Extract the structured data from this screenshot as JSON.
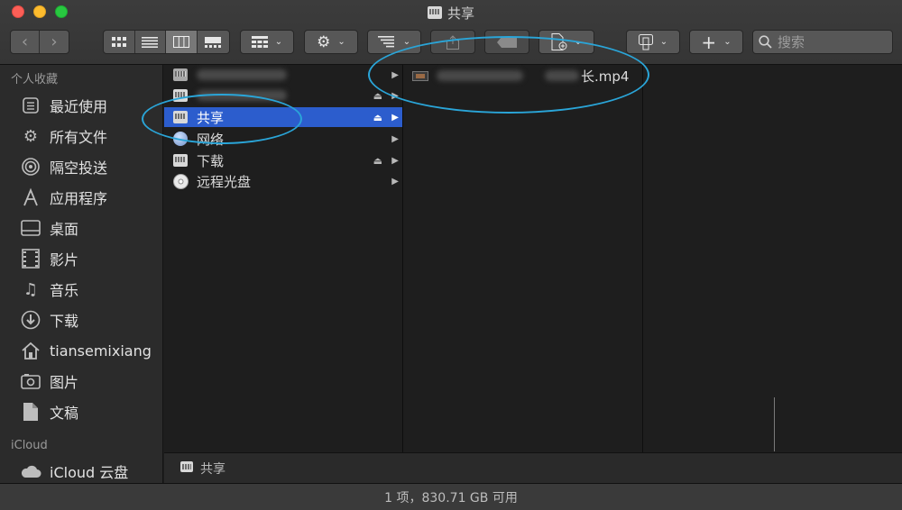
{
  "window": {
    "title": "共享"
  },
  "toolbar": {
    "view_modes": [
      "icon-view",
      "list-view",
      "column-view",
      "gallery-view"
    ],
    "active_view": "column-view",
    "group_by": "group-icon",
    "action": "gear-icon",
    "arrange": "arrange-icon",
    "share": "share-icon",
    "tag": "tag-icon",
    "new_doc": "new-document-icon",
    "dropbox": "dropbox-icon",
    "add": "+",
    "search_placeholder": "搜索"
  },
  "sidebar": {
    "favorites_header": "个人收藏",
    "favorites": [
      {
        "label": "最近使用",
        "icon": "recent-icon"
      },
      {
        "label": "所有文件",
        "icon": "gear-icon"
      },
      {
        "label": "隔空投送",
        "icon": "airdrop-icon"
      },
      {
        "label": "应用程序",
        "icon": "applications-icon"
      },
      {
        "label": "桌面",
        "icon": "desktop-icon"
      },
      {
        "label": "影片",
        "icon": "movies-icon"
      },
      {
        "label": "音乐",
        "icon": "music-icon"
      },
      {
        "label": "下载",
        "icon": "downloads-icon"
      },
      {
        "label": "tiansemixiang",
        "icon": "home-icon"
      },
      {
        "label": "图片",
        "icon": "pictures-icon"
      },
      {
        "label": "文稿",
        "icon": "documents-icon"
      }
    ],
    "icloud_header": "iCloud",
    "icloud": [
      {
        "label": "iCloud 云盘",
        "icon": "cloud-icon"
      }
    ]
  },
  "column1": {
    "items": [
      {
        "label": "",
        "icon": "drive-icon",
        "blurred": true
      },
      {
        "label": "",
        "icon": "drive-icon",
        "blurred": true,
        "eject": true
      },
      {
        "label": "共享",
        "icon": "drive-icon",
        "selected": true,
        "eject": true
      },
      {
        "label": "网络",
        "icon": "network-icon"
      },
      {
        "label": "下载",
        "icon": "drive-icon",
        "eject": true
      },
      {
        "label": "远程光盘",
        "icon": "disc-icon"
      }
    ]
  },
  "column2": {
    "items": [
      {
        "label": "长.mp4",
        "icon": "video-file-icon",
        "blurred_prefix": true
      }
    ]
  },
  "pathbar": {
    "label": "共享"
  },
  "status": {
    "text": "1 项，830.71 GB 可用"
  },
  "colors": {
    "selection": "#2c5dcd",
    "annotation": "#2aa5d8"
  }
}
